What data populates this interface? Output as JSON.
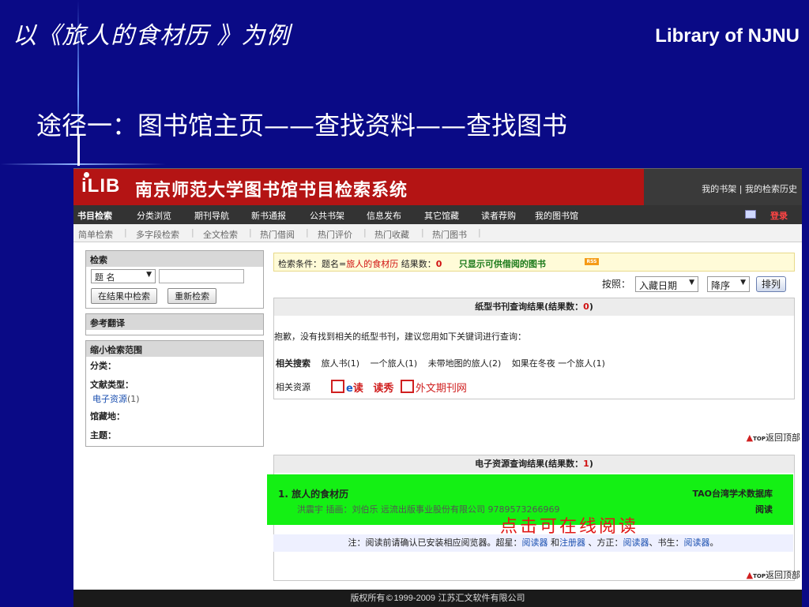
{
  "slide": {
    "title": "以《旅人的食材历 》为例",
    "brand": "Library of NJNU",
    "subtitle": "途径一：图书馆主页——查找资料——查找图书"
  },
  "header": {
    "logo": "iLIB",
    "system_title": "南京师范大学图书馆书目检索系统",
    "links": "我的书架 | 我的检索历史"
  },
  "nav": {
    "items": [
      "书目检索",
      "分类浏览",
      "期刊导航",
      "新书通报",
      "公共书架",
      "信息发布",
      "其它馆藏",
      "读者荐购",
      "我的图书馆"
    ],
    "login": "登录"
  },
  "subnav": {
    "items": [
      "简单检索",
      "多字段检索",
      "全文检索",
      "热门借阅",
      "热门评价",
      "热门收藏",
      "热门图书"
    ]
  },
  "left": {
    "search_header": "检索",
    "field_select": "题 名",
    "search_in_results": "在结果中检索",
    "research": "重新检索",
    "ref_header": "参考翻译",
    "narrow_header": "缩小检索范围",
    "category_label": "分类：",
    "doctype_label": "文献类型：",
    "doctype_value": "电子资源",
    "doctype_count": "(1)",
    "location_label": "馆藏地：",
    "subject_label": "主题："
  },
  "condition": {
    "prefix": "检索条件：题名=",
    "term": "旅人的食材历",
    "count_label": " 结果数：",
    "count": "0",
    "only_lendable": "只显示可供借阅的图书",
    "rss": "RSS"
  },
  "sort": {
    "label": "按照：",
    "by": "入藏日期",
    "order": "降序",
    "button": "排列"
  },
  "paper": {
    "title_prefix": "纸型书刊查询结果(结果数：",
    "count": "0",
    "title_suffix": ")",
    "sorry": "抱歉，没有找到相关的纸型书刊，建议您用如下关键词进行查询：",
    "related_label": "相关搜索",
    "keywords": [
      "旅人书(1)",
      "一个旅人(1)",
      "未带地图的旅人(2)",
      "如果在冬夜 一个旅人(1)"
    ],
    "resources_label": "相关资源",
    "res_e": "e",
    "res_du": "读",
    "res_duxiu": "读秀",
    "res_foreign": "外文期刊网",
    "back_top": "返回顶部",
    "top_tag": "TOP"
  },
  "electronic": {
    "title_prefix": "电子资源查询结果(结果数：",
    "count": "1",
    "title_suffix": ")",
    "item_title": "1. 旅人的食材历",
    "item_meta": "洪震宇 插画：刘伯乐  远流出版事业股份有限公司  9789573266969",
    "database": "TAO台湾学术数据库",
    "read": "阅读",
    "annotation": "点击可在线阅读",
    "note_prefix": "注：阅读前请确认已安装相应阅览器。超星：",
    "reader": "阅读器",
    "and": " 和",
    "register": "注册器",
    "fangzheng": " 、方正：",
    "shusheng": "、书生：",
    "period": "。",
    "back_top": "返回顶部",
    "top_tag": "TOP"
  },
  "footer": {
    "prefix": "版权所有©",
    "years": "1999-2009",
    "company": " 江苏汇文软件有限公司"
  }
}
